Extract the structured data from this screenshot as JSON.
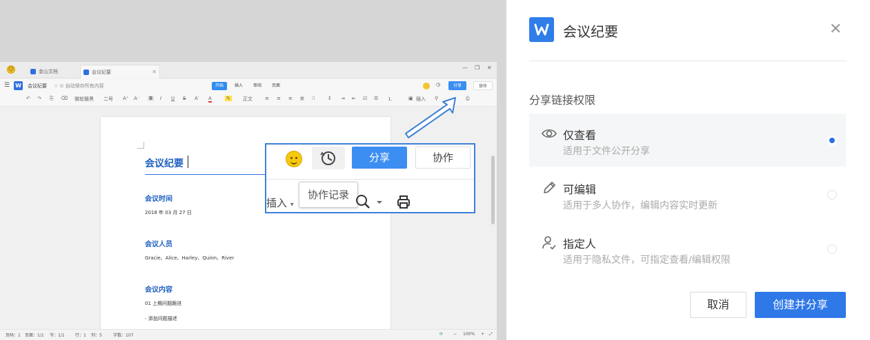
{
  "window": {
    "tabs": [
      {
        "label": "金山文档",
        "active": false
      },
      {
        "label": "会议纪要",
        "active": true
      }
    ],
    "controls": [
      "—",
      "❐",
      "✕"
    ]
  },
  "menubar": {
    "doc_name": "会议纪要",
    "autosave": "☆ ⊙ 自动保存所有内容",
    "tabs": [
      "开始",
      "插入",
      "审阅",
      "页面"
    ],
    "active_tab": "开始",
    "share_label": "分享",
    "collab_label": "协作"
  },
  "toolbar": {
    "font_family": "微软雅黑",
    "font_size": "二号",
    "style": "正文",
    "insert": "插入"
  },
  "document": {
    "title": "会议纪要",
    "sections": [
      {
        "heading": "会议时间",
        "lines": [
          "2018 年 03 月 27 日"
        ]
      },
      {
        "heading": "会议人员",
        "lines": [
          "Gracie、Alice、Harley、Quinn、River"
        ]
      },
      {
        "heading": "会议内容",
        "lines": [
          "01 上期问题跟进",
          "- 添加问题描述"
        ]
      }
    ]
  },
  "statusbar": {
    "page": "页码：1",
    "pages": "页面：1/1",
    "section": "节：1/1",
    "row": "行：1",
    "col": "列：5",
    "words": "字数：107",
    "zoom": "100%"
  },
  "callout": {
    "share_label": "分享",
    "collab_label": "协作",
    "insert_label": "插入",
    "tooltip": "协作记录"
  },
  "dialog": {
    "title": "会议纪要",
    "section_label": "分享链接权限",
    "options": [
      {
        "title": "仅查看",
        "desc": "适用于文件公开分享",
        "icon": "eye-icon",
        "selected": true
      },
      {
        "title": "可编辑",
        "desc": "适用于多人协作，编辑内容实时更新",
        "icon": "pencil-icon",
        "selected": false
      },
      {
        "title": "指定人",
        "desc": "适用于隐私文件，可指定查看/编辑权限",
        "icon": "user-check-icon",
        "selected": false
      }
    ],
    "cancel_label": "取消",
    "create_label": "创建并分享"
  },
  "colors": {
    "accent": "#2f78e8",
    "heading_blue": "#1e5fbf",
    "callout_border": "#3d7fd6"
  }
}
